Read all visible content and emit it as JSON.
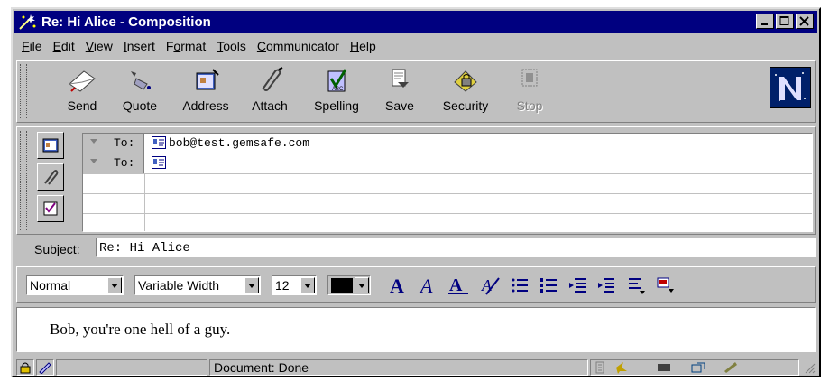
{
  "window": {
    "title": "Re: Hi Alice - Composition",
    "controls": [
      "minimize",
      "maximize",
      "close"
    ]
  },
  "menubar": {
    "items": [
      {
        "label": "File",
        "accel": "F"
      },
      {
        "label": "Edit",
        "accel": "E"
      },
      {
        "label": "View",
        "accel": "V"
      },
      {
        "label": "Insert",
        "accel": "I"
      },
      {
        "label": "Format",
        "accel": "o"
      },
      {
        "label": "Tools",
        "accel": "T"
      },
      {
        "label": "Communicator",
        "accel": "C"
      },
      {
        "label": "Help",
        "accel": "H"
      }
    ]
  },
  "toolbar": {
    "send": "Send",
    "quote": "Quote",
    "address": "Address",
    "attach": "Attach",
    "spelling": "Spelling",
    "save": "Save",
    "security": "Security",
    "stop": "Stop"
  },
  "addressing": {
    "rows": [
      {
        "type": "To:",
        "value": "bob@test.gemsafe.com"
      },
      {
        "type": "To:",
        "value": ""
      }
    ]
  },
  "subject": {
    "label": "Subject:",
    "value": "Re: Hi Alice"
  },
  "format": {
    "paragraph_style": "Normal",
    "font": "Variable Width",
    "size": "12",
    "color": "#000000"
  },
  "message": {
    "body": "Bob, you're one hell of a guy."
  },
  "status": {
    "text": "Document: Done"
  }
}
